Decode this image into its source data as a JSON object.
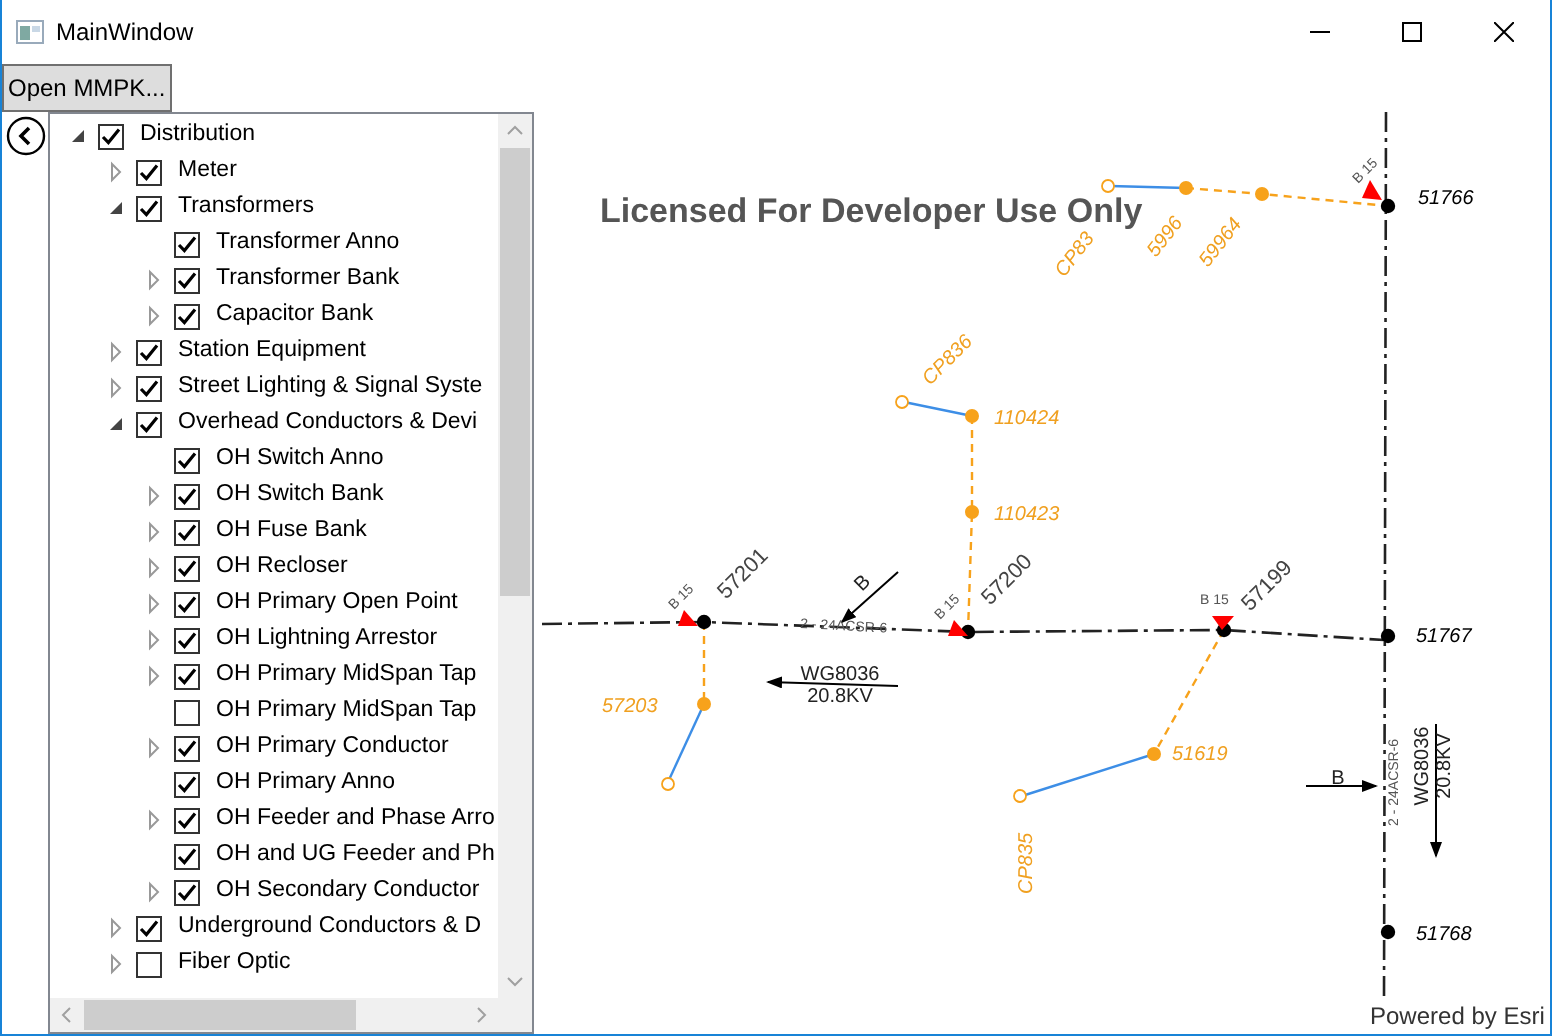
{
  "window": {
    "title": "MainWindow"
  },
  "toolbar": {
    "open_button": "Open MMPK..."
  },
  "layers": {
    "items": [
      {
        "label": "Distribution",
        "checked": true,
        "expanded": true,
        "children": [
          {
            "label": "Meter",
            "checked": true,
            "expanded": false
          },
          {
            "label": "Transformers",
            "checked": true,
            "expanded": true,
            "children": [
              {
                "label": "Transformer Anno",
                "checked": true
              },
              {
                "label": "Transformer Bank",
                "checked": true,
                "expanded": false
              },
              {
                "label": "Capacitor Bank",
                "checked": true,
                "expanded": false
              }
            ]
          },
          {
            "label": "Station Equipment",
            "checked": true,
            "expanded": false
          },
          {
            "label": "Street Lighting & Signal Syste",
            "checked": true,
            "expanded": false
          },
          {
            "label": "Overhead Conductors & Devi",
            "checked": true,
            "expanded": true,
            "children": [
              {
                "label": "OH Switch Anno",
                "checked": true
              },
              {
                "label": "OH Switch Bank",
                "checked": true,
                "expanded": false
              },
              {
                "label": "OH Fuse Bank",
                "checked": true,
                "expanded": false
              },
              {
                "label": "OH Recloser",
                "checked": true,
                "expanded": false
              },
              {
                "label": "OH Primary Open Point",
                "checked": true,
                "expanded": false
              },
              {
                "label": "OH Lightning Arrestor",
                "checked": true,
                "expanded": false
              },
              {
                "label": "OH Primary MidSpan Tap",
                "checked": true,
                "expanded": false
              },
              {
                "label": "OH Primary MidSpan Tap",
                "checked": false
              },
              {
                "label": "OH Primary Conductor",
                "checked": true,
                "expanded": false
              },
              {
                "label": "OH Primary Anno",
                "checked": true
              },
              {
                "label": "OH Feeder and Phase Arro",
                "checked": true,
                "expanded": false
              },
              {
                "label": "OH and UG Feeder and Ph",
                "checked": true
              },
              {
                "label": "OH Secondary Conductor",
                "checked": true,
                "expanded": false
              }
            ]
          },
          {
            "label": "Underground Conductors & D",
            "checked": true,
            "expanded": false
          },
          {
            "label": "Fiber Optic",
            "checked": false,
            "expanded": false
          }
        ]
      }
    ]
  },
  "map": {
    "labels": [
      {
        "text": "Licensed For Developer Use Only",
        "kind": "watermark"
      },
      {
        "text": "CP83",
        "kind": "feature"
      },
      {
        "text": "5996",
        "kind": "feature"
      },
      {
        "text": "59964",
        "kind": "feature"
      },
      {
        "text": "B 15",
        "kind": "phase"
      },
      {
        "text": "51766",
        "kind": "node"
      },
      {
        "text": "CP836",
        "kind": "feature"
      },
      {
        "text": "110424",
        "kind": "feature"
      },
      {
        "text": "110423",
        "kind": "feature"
      },
      {
        "text": "B 15",
        "kind": "phase"
      },
      {
        "text": "57201",
        "kind": "device"
      },
      {
        "text": "B",
        "kind": "flow"
      },
      {
        "text": "2 - 24ACSR-6",
        "kind": "phase"
      },
      {
        "text": "B 15",
        "kind": "phase"
      },
      {
        "text": "57200",
        "kind": "device"
      },
      {
        "text": "B 15",
        "kind": "phase"
      },
      {
        "text": "57199",
        "kind": "device"
      },
      {
        "text": "51767",
        "kind": "node"
      },
      {
        "text": "WG8036",
        "kind": "flow"
      },
      {
        "text": "20.8KV",
        "kind": "flow"
      },
      {
        "text": "57203",
        "kind": "feature"
      },
      {
        "text": "51619",
        "kind": "feature"
      },
      {
        "text": "B",
        "kind": "flow"
      },
      {
        "text": "2 - 24ACSR-6",
        "kind": "phase"
      },
      {
        "text": "WG8036",
        "kind": "flow"
      },
      {
        "text": "20.8KV",
        "kind": "flow"
      },
      {
        "text": "CP835",
        "kind": "feature"
      },
      {
        "text": "51768",
        "kind": "node"
      },
      {
        "text": "Powered by Esri",
        "kind": "attribution"
      }
    ]
  }
}
